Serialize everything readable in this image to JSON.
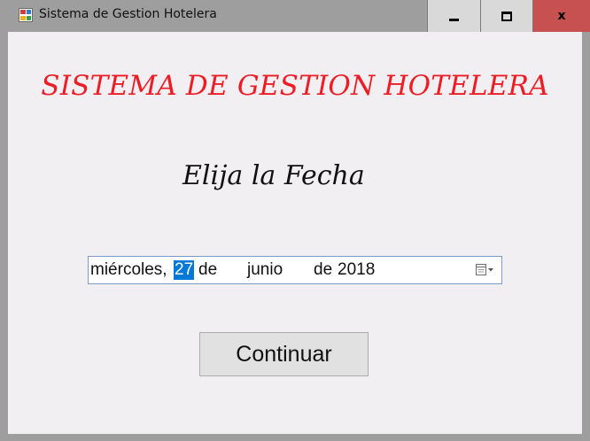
{
  "window": {
    "title": "Sistema de Gestion Hotelera",
    "icons": {
      "app": "app-window-icon",
      "minimize": "minimize-icon",
      "maximize": "maximize-icon",
      "close": "close-icon"
    },
    "close_glyph": "x"
  },
  "main": {
    "heading": "SISTEMA DE GESTION HOTELERA",
    "subheading": "Elija la Fecha",
    "date_picker": {
      "weekday": "miércoles,",
      "day": "27",
      "sep1": "de",
      "month": "junio",
      "sep2": "de",
      "year": "2018",
      "dropdown_icon": "calendar-dropdown-icon"
    },
    "continue_label": "Continuar"
  },
  "colors": {
    "heading": "#ee1c24",
    "selection": "#0078d7",
    "close_button": "#c75050",
    "client_background": "#f1eff1"
  }
}
